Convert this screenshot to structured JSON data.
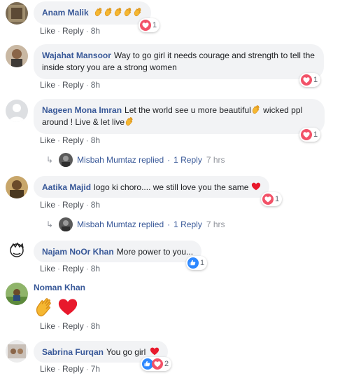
{
  "comments": [
    {
      "author": "Anam Malik",
      "text": "",
      "emoji_tail": "👏👏👏👏👏",
      "like": "Like",
      "reply": "Reply",
      "time": "8h",
      "react_count": "1"
    },
    {
      "author": "Wajahat Mansoor",
      "text": "Way to go girl it needs courage and strength to tell the inside story you are a strong women",
      "like": "Like",
      "reply": "Reply",
      "time": "8h",
      "react_count": "1"
    },
    {
      "author": "Nageen Mona Imran",
      "text_a": "Let the world see u more beautiful",
      "text_b": " wicked ppl around ! Live & let live",
      "like": "Like",
      "reply": "Reply",
      "time": "8h",
      "react_count": "1",
      "replies": {
        "name": "Misbah Mumtaz replied",
        "count": "1 Reply",
        "time": "7 hrs"
      }
    },
    {
      "author": "Aatika Majid",
      "text": "logo ki choro.... we still love you the same",
      "like": "Like",
      "reply": "Reply",
      "time": "8h",
      "react_count": "1",
      "replies": {
        "name": "Misbah Mumtaz replied",
        "count": "1 Reply",
        "time": "7 hrs"
      }
    },
    {
      "author": "Najam NoOr Khan",
      "text": "More power to you...",
      "like": "Like",
      "reply": "Reply",
      "time": "8h",
      "react_count": "1"
    },
    {
      "author": "Noman Khan",
      "like": "Like",
      "reply": "Reply",
      "time": "8h"
    },
    {
      "author": "Sabrina Furqan",
      "text": "You go girl",
      "like": "Like",
      "reply": "Reply",
      "time": "7h",
      "react_count": "2"
    }
  ],
  "colors": {
    "author": "#385898",
    "bubble": "#f2f3f5",
    "heart": "#f25268",
    "like": "#2d88ff"
  }
}
